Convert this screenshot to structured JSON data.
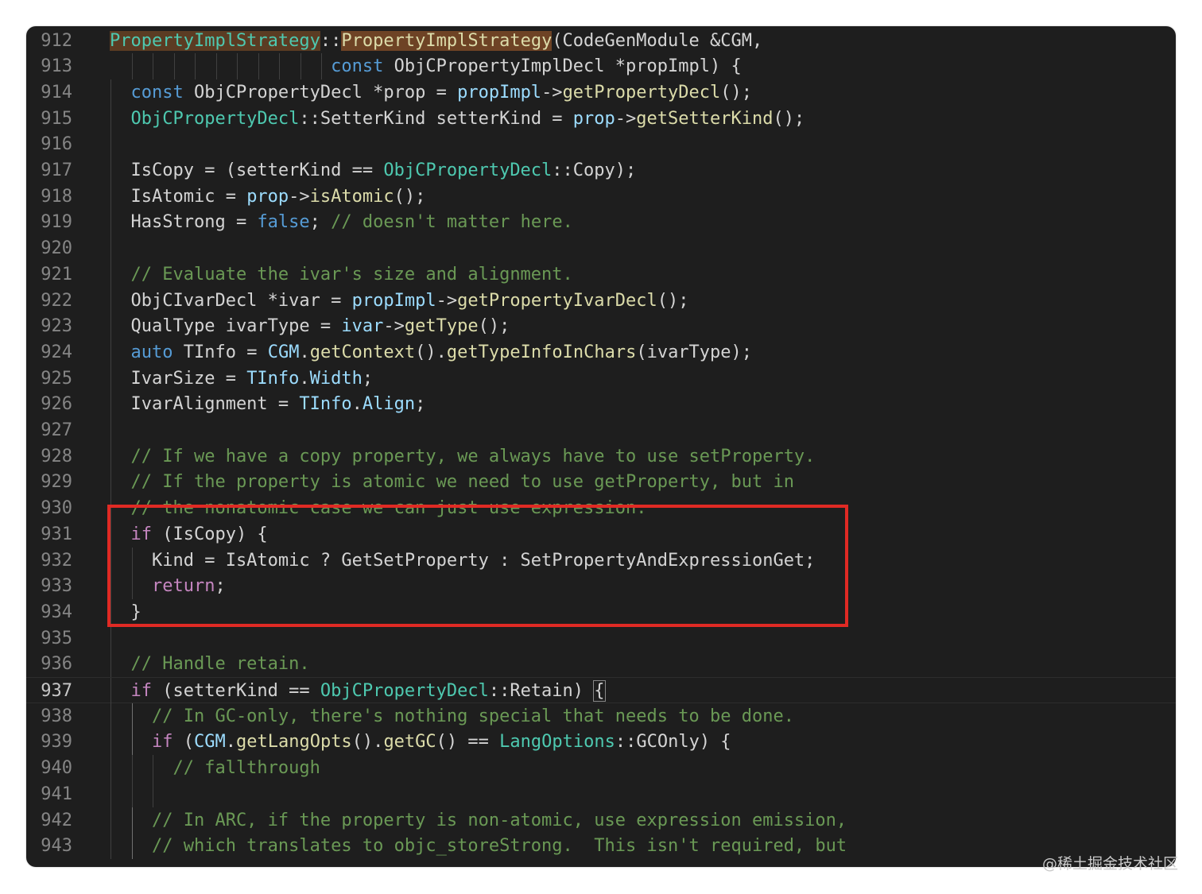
{
  "editor": {
    "lines": [
      {
        "num": "912",
        "tokens": [
          [
            "PropertyImplStrategy",
            "hlcls"
          ],
          [
            "::",
            "op"
          ],
          [
            "PropertyImplStrategy",
            "hl"
          ],
          [
            "(CodeGenModule &CGM,",
            "plain"
          ]
        ]
      },
      {
        "num": "913",
        "tokens": [
          [
            "                     const",
            "kw"
          ],
          [
            " ObjCPropertyImplDecl *propImpl) {",
            "plain"
          ]
        ]
      },
      {
        "num": "914",
        "tokens": [
          [
            "  const",
            "kw"
          ],
          [
            " ObjCPropertyDecl *prop = ",
            "plain"
          ],
          [
            "propImpl",
            "var"
          ],
          [
            "->",
            "op"
          ],
          [
            "getPropertyDecl",
            "fn"
          ],
          [
            "();",
            "plain"
          ]
        ]
      },
      {
        "num": "915",
        "tokens": [
          [
            "  ObjCPropertyDecl",
            "type"
          ],
          [
            "::SetterKind setterKind = ",
            "plain"
          ],
          [
            "prop",
            "var"
          ],
          [
            "->",
            "op"
          ],
          [
            "getSetterKind",
            "fn"
          ],
          [
            "();",
            "plain"
          ]
        ]
      },
      {
        "num": "916",
        "tokens": []
      },
      {
        "num": "917",
        "tokens": [
          [
            "  IsCopy = (setterKind == ",
            "plain"
          ],
          [
            "ObjCPropertyDecl",
            "type"
          ],
          [
            "::Copy);",
            "plain"
          ]
        ]
      },
      {
        "num": "918",
        "tokens": [
          [
            "  IsAtomic = ",
            "plain"
          ],
          [
            "prop",
            "var"
          ],
          [
            "->",
            "op"
          ],
          [
            "isAtomic",
            "fn"
          ],
          [
            "();",
            "plain"
          ]
        ]
      },
      {
        "num": "919",
        "tokens": [
          [
            "  HasStrong = ",
            "plain"
          ],
          [
            "false",
            "kw"
          ],
          [
            "; ",
            "plain"
          ],
          [
            "// doesn't matter here.",
            "com"
          ]
        ]
      },
      {
        "num": "920",
        "tokens": []
      },
      {
        "num": "921",
        "tokens": [
          [
            "  // Evaluate the ivar's size and alignment.",
            "com"
          ]
        ]
      },
      {
        "num": "922",
        "tokens": [
          [
            "  ObjCIvarDecl *ivar = ",
            "plain"
          ],
          [
            "propImpl",
            "var"
          ],
          [
            "->",
            "op"
          ],
          [
            "getPropertyIvarDecl",
            "fn"
          ],
          [
            "();",
            "plain"
          ]
        ]
      },
      {
        "num": "923",
        "tokens": [
          [
            "  QualType ivarType = ",
            "plain"
          ],
          [
            "ivar",
            "var"
          ],
          [
            "->",
            "op"
          ],
          [
            "getType",
            "fn"
          ],
          [
            "();",
            "plain"
          ]
        ]
      },
      {
        "num": "924",
        "tokens": [
          [
            "  auto",
            "kw"
          ],
          [
            " TInfo = ",
            "plain"
          ],
          [
            "CGM",
            "var"
          ],
          [
            ".",
            "op"
          ],
          [
            "getContext",
            "fn"
          ],
          [
            "().",
            "plain"
          ],
          [
            "getTypeInfoInChars",
            "fn"
          ],
          [
            "(ivarType);",
            "plain"
          ]
        ]
      },
      {
        "num": "925",
        "tokens": [
          [
            "  IvarSize = ",
            "plain"
          ],
          [
            "TInfo",
            "var"
          ],
          [
            ".",
            "op"
          ],
          [
            "Width",
            "var"
          ],
          [
            ";",
            "plain"
          ]
        ]
      },
      {
        "num": "926",
        "tokens": [
          [
            "  IvarAlignment = ",
            "plain"
          ],
          [
            "TInfo",
            "var"
          ],
          [
            ".",
            "op"
          ],
          [
            "Align",
            "var"
          ],
          [
            ";",
            "plain"
          ]
        ]
      },
      {
        "num": "927",
        "tokens": []
      },
      {
        "num": "928",
        "tokens": [
          [
            "  // If we have a copy property, we always have to use setProperty.",
            "com"
          ]
        ]
      },
      {
        "num": "929",
        "tokens": [
          [
            "  // If the property is atomic we need to use getProperty, but in",
            "com"
          ]
        ]
      },
      {
        "num": "930",
        "tokens": [
          [
            "  // the nonatomic case we can just use expression.",
            "com"
          ]
        ]
      },
      {
        "num": "931",
        "tokens": [
          [
            "  if",
            "ctrl"
          ],
          [
            " (IsCopy) {",
            "plain"
          ]
        ]
      },
      {
        "num": "932",
        "tokens": [
          [
            "    Kind = IsAtomic ? GetSetProperty : SetPropertyAndExpressionGet;",
            "plain"
          ]
        ]
      },
      {
        "num": "933",
        "tokens": [
          [
            "    return",
            "ctrl"
          ],
          [
            ";",
            "plain"
          ]
        ]
      },
      {
        "num": "934",
        "tokens": [
          [
            "  }",
            "plain"
          ]
        ]
      },
      {
        "num": "935",
        "tokens": []
      },
      {
        "num": "936",
        "tokens": [
          [
            "  // Handle retain.",
            "com"
          ]
        ]
      },
      {
        "num": "937",
        "tokens": [
          [
            "  if",
            "ctrl"
          ],
          [
            " (setterKind == ",
            "plain"
          ],
          [
            "ObjCPropertyDecl",
            "type"
          ],
          [
            "::Retain) ",
            "plain"
          ],
          [
            "{",
            "brk"
          ]
        ]
      },
      {
        "num": "938",
        "tokens": [
          [
            "    // In GC-only, there's nothing special that needs to be done.",
            "com"
          ]
        ]
      },
      {
        "num": "939",
        "tokens": [
          [
            "    if",
            "ctrl"
          ],
          [
            " (",
            "plain"
          ],
          [
            "CGM",
            "var"
          ],
          [
            ".",
            "op"
          ],
          [
            "getLangOpts",
            "fn"
          ],
          [
            "().",
            "plain"
          ],
          [
            "getGC",
            "fn"
          ],
          [
            "() == ",
            "plain"
          ],
          [
            "LangOptions",
            "type"
          ],
          [
            "::GCOnly) {",
            "plain"
          ]
        ]
      },
      {
        "num": "940",
        "tokens": [
          [
            "      // fallthrough",
            "com"
          ]
        ]
      },
      {
        "num": "941",
        "tokens": []
      },
      {
        "num": "942",
        "tokens": [
          [
            "    // In ARC, if the property is non-atomic, use expression emission,",
            "com"
          ]
        ]
      },
      {
        "num": "943",
        "tokens": [
          [
            "    // which translates to objc_storeStrong.  This isn't required, but",
            "com"
          ]
        ]
      }
    ]
  },
  "colors": {
    "background": "#1e1e1e",
    "highlight_box": "#e02a24",
    "comment": "#6a9955",
    "keyword": "#569cd6",
    "control": "#c586c0",
    "type": "#4ec9b0",
    "function": "#dcdcaa",
    "variable": "#9cdcfe"
  },
  "watermark": "@稀土掘金技术社区"
}
